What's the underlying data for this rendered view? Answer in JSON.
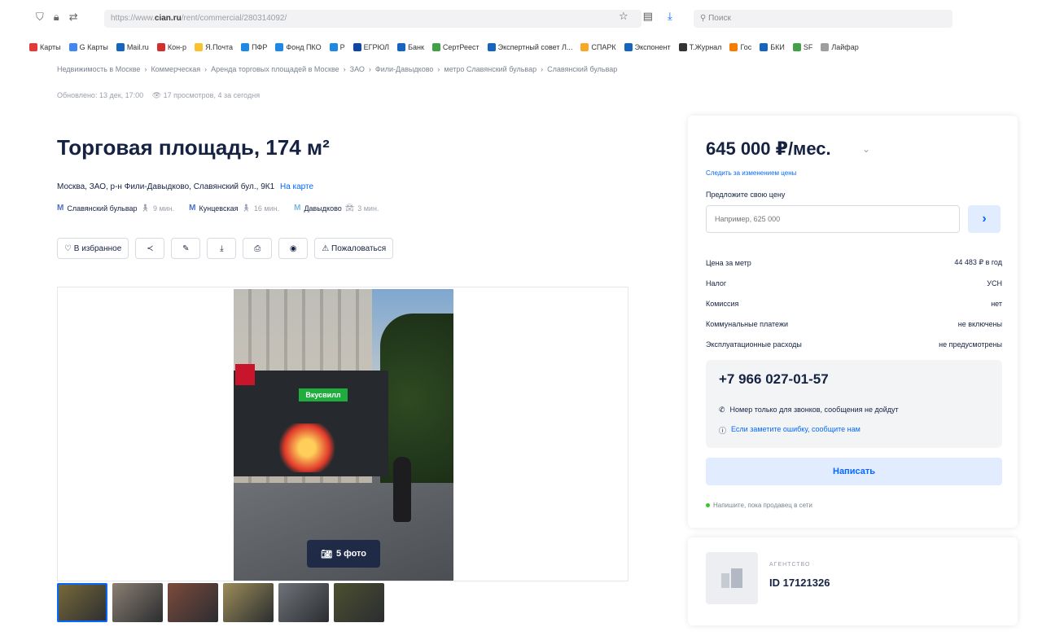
{
  "browser": {
    "url_prefix": "https://www.",
    "url_domain": "cian.ru",
    "url_path": "/rent/commercial/280314092/",
    "search_placeholder": "Поиск"
  },
  "bookmarks": [
    {
      "label": "Карты",
      "color": "#e53935"
    },
    {
      "label": "G Карты",
      "color": "#4285f4"
    },
    {
      "label": "Mail.ru",
      "color": "#1565c0"
    },
    {
      "label": "Кон-р",
      "color": "#d32f2f"
    },
    {
      "label": "Я.Почта",
      "color": "#fbc02d"
    },
    {
      "label": "ПФР",
      "color": "#1e88e5"
    },
    {
      "label": "Фонд ПКО",
      "color": "#1e88e5"
    },
    {
      "label": "Р",
      "color": "#1e88e5"
    },
    {
      "label": "ЕГРЮЛ",
      "color": "#0d47a1"
    },
    {
      "label": "Банк",
      "color": "#1565c0"
    },
    {
      "label": "СертРеест",
      "color": "#43a047"
    },
    {
      "label": "Экспертный совет Л...",
      "color": "#1565c0"
    },
    {
      "label": "СПАРК",
      "color": "#f9a825"
    },
    {
      "label": "Экспонент",
      "color": "#1565c0"
    },
    {
      "label": "Т.Журнал",
      "color": "#333333"
    },
    {
      "label": "Гос",
      "color": "#f57c00"
    },
    {
      "label": "БКИ",
      "color": "#1565c0"
    },
    {
      "label": "SF",
      "color": "#43a047"
    },
    {
      "label": "Лайфар",
      "color": "#9e9e9e"
    }
  ],
  "breadcrumbs": [
    "Недвижимость в Москве",
    "Коммерческая",
    "Аренда торговых площадей в Москве",
    "ЗАО",
    "Фили-Давыдково",
    "метро Славянский бульвар",
    "Славянский бульвар"
  ],
  "updated": "Обновлено: 13 дек, 17:00",
  "views": "17 просмотров, 4 за сегодня",
  "listing": {
    "title": "Торговая площадь, 174 м²",
    "address": "Москва, ЗАО, р-н Фили-Давыдково, Славянский бул., 9К1",
    "map_link": "На карте",
    "metro": [
      {
        "name": "Славянский бульвар",
        "time": "9 мин."
      },
      {
        "name": "Кунцевская",
        "time": "16 мин."
      },
      {
        "name": "Давыдково",
        "time": "3 мин."
      }
    ]
  },
  "actions": {
    "favorite": "В избранное",
    "complain": "Пожаловаться"
  },
  "gallery": {
    "photo_count": "5 фото",
    "sign_text": "Вкусвилл",
    "thumb_colors": [
      "#7a6b3a",
      "#8b7f72",
      "#7d4a3c",
      "#9c8d5a",
      "#6f747a",
      "#4c5030"
    ]
  },
  "sidebar": {
    "price": "645 000 ₽/мес.",
    "follow_price": "Следить за изменением цены",
    "offer_label": "Предложите свою цену",
    "offer_placeholder": "Например, 625 000",
    "params": [
      {
        "label": "Цена за метр",
        "value": "44 483 ₽ в год"
      },
      {
        "label": "Налог",
        "value": "УСН"
      },
      {
        "label": "Комиссия",
        "value": "нет"
      },
      {
        "label": "Коммунальные платежи",
        "value": "не включены"
      },
      {
        "label": "Эксплуатационные расходы",
        "value": "не предусмотрены"
      }
    ],
    "phone": "+7 966 027-01-57",
    "phone_note": "Номер только для звонков, сообщения не дойдут",
    "phone_note2": "Если заметите ошибку, сообщите нам",
    "write_button": "Написать",
    "online_note": "Напишите, пока продавец в сети"
  },
  "agent": {
    "role": "АГЕНТСТВО",
    "id": "ID 17121326"
  },
  "colors": {
    "accent": "#0468ff",
    "text": "#152242"
  }
}
